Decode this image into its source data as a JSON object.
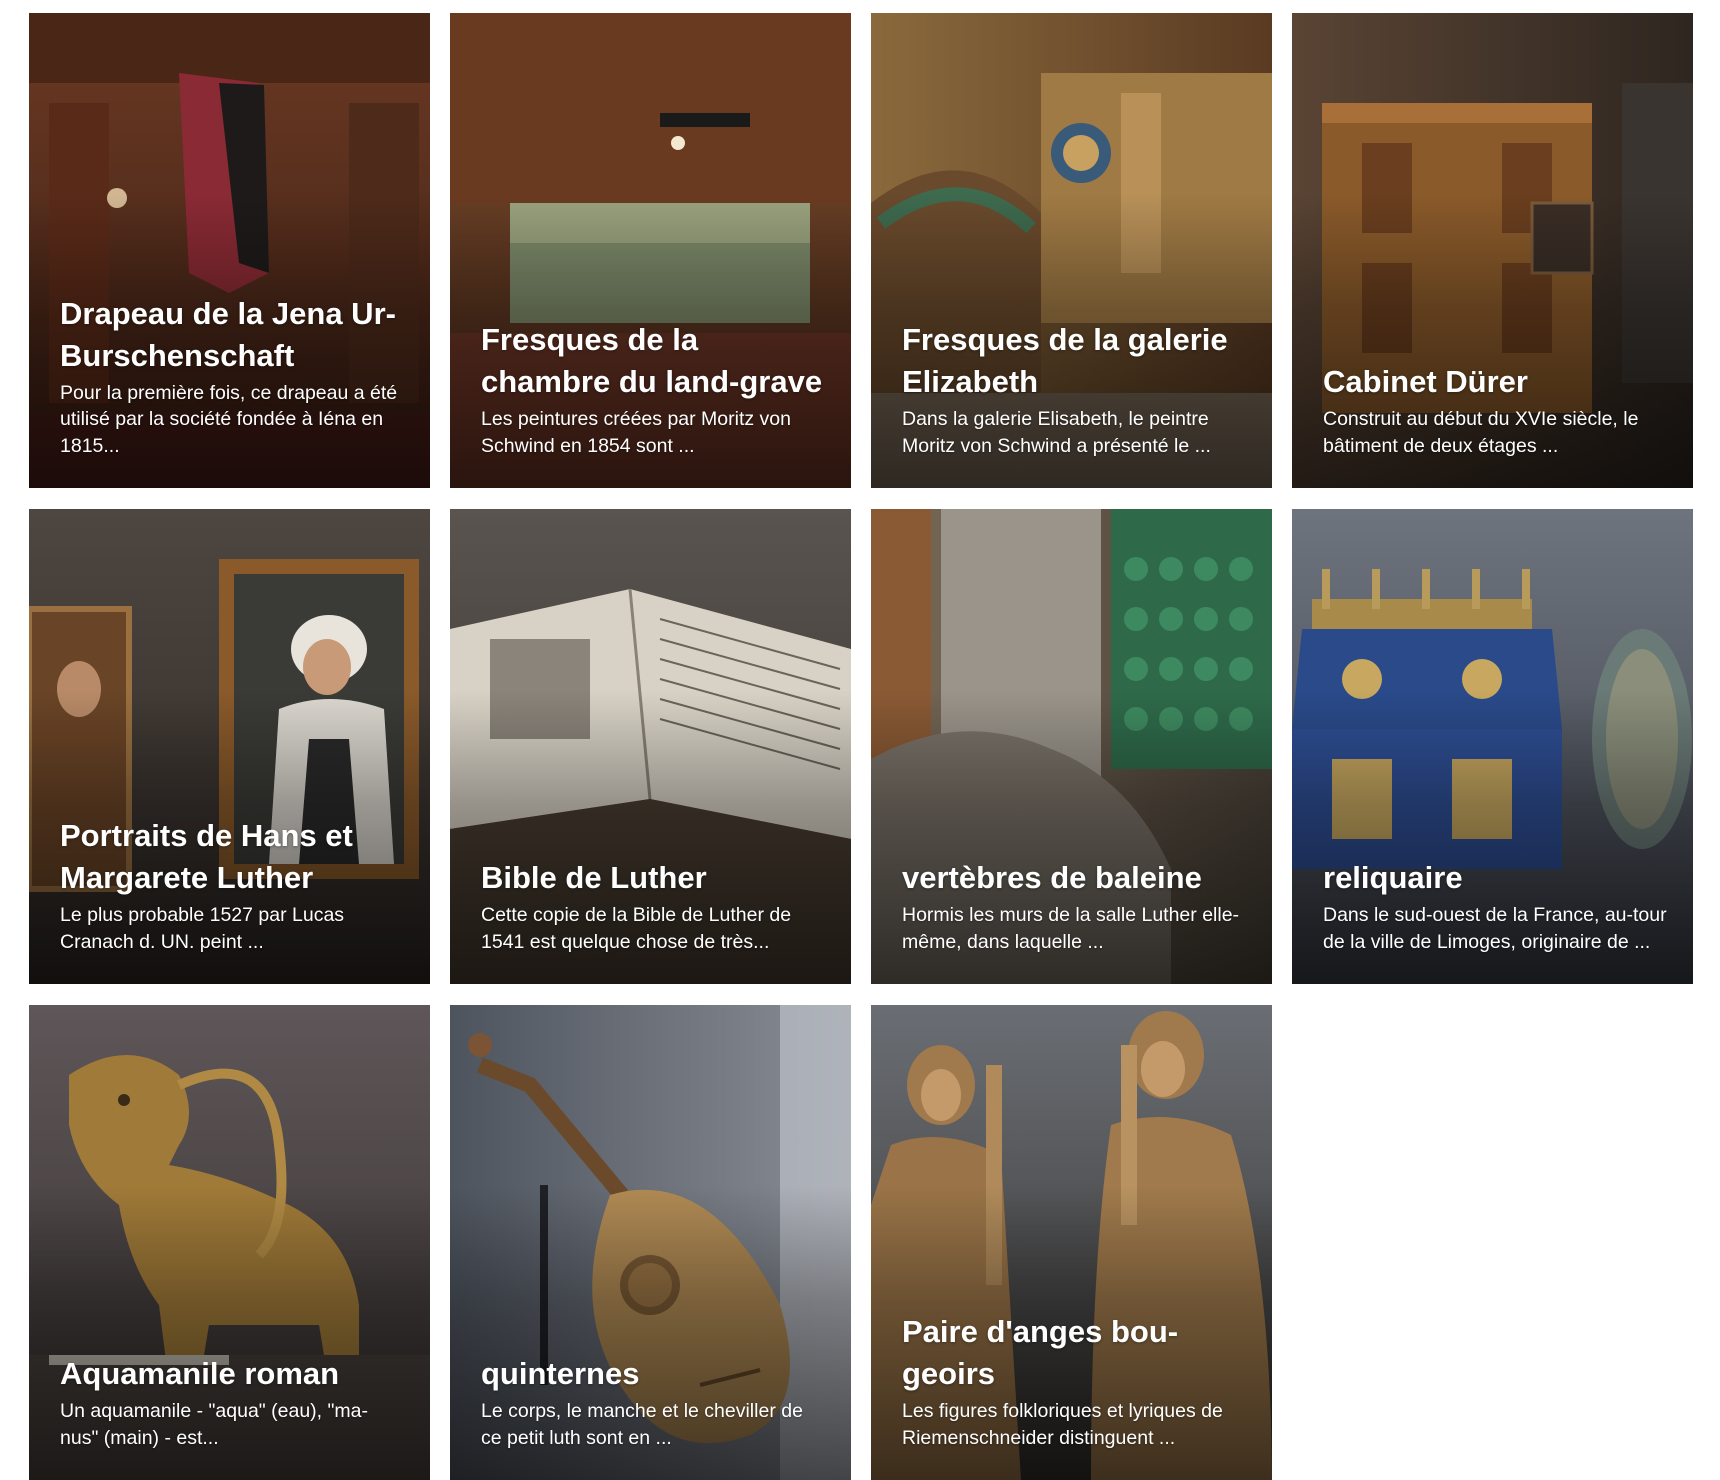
{
  "cards": [
    {
      "title": "Drapeau de la Jena Ur-Burschenschaft",
      "excerpt": "Pour la première fois, ce drapeau a été utilisé par la société fondée à Iéna en 1815...",
      "image": "hall-with-flag",
      "colors": [
        "#6b3a24",
        "#3a1d12"
      ]
    },
    {
      "title": "Fresques de la chambre du land-grave",
      "excerpt": "Les peintures créées par Moritz von Schwind en 1854 sont ...",
      "image": "room-with-fresco",
      "colors": [
        "#7a4a2b",
        "#4a2a1a"
      ]
    },
    {
      "title": "Fresques de la galerie Elizabeth",
      "excerpt": "Dans la galerie Elisabeth, le peintre Moritz von Schwind a présenté le ...",
      "image": "painted-gallery",
      "colors": [
        "#8a6a3c",
        "#5a3a22"
      ]
    },
    {
      "title": "Cabinet Dürer",
      "excerpt": "Construit au début du XVIe siècle, le bâtiment de deux étages ...",
      "image": "wooden-cabinet",
      "colors": [
        "#6b4a2a",
        "#3a2a1e"
      ]
    },
    {
      "title": "Portraits de Hans et Margarete Luther",
      "excerpt": "Le plus probable 1527 par Lucas Cranach d. UN. peint ...",
      "image": "framed-portraits",
      "colors": [
        "#4e4640",
        "#2e2824"
      ]
    },
    {
      "title": "Bible de Luther",
      "excerpt": "Cette copie de la Bible de Luther de 1541 est quelque chose de très...",
      "image": "open-book",
      "colors": [
        "#5a5450",
        "#36302c"
      ]
    },
    {
      "title": "vertèbres de baleine",
      "excerpt": "Hormis les murs de la salle Luther elle-même, dans laquelle ...",
      "image": "whale-vertebra-and-stove",
      "colors": [
        "#6e6254",
        "#3a4a3a"
      ]
    },
    {
      "title": "reliquaire",
      "excerpt": "Dans le sud-ouest de la France, au-tour de la ville de Limoges, originaire de ...",
      "image": "enamel-reliquary",
      "colors": [
        "#5e6470",
        "#3a3e48"
      ]
    },
    {
      "title": "Aquamanile roman",
      "excerpt": "Un aquamanile - \"aqua\" (eau), \"ma-nus\" (main) - est...",
      "image": "bronze-lion",
      "colors": [
        "#5a5254",
        "#36302e"
      ]
    },
    {
      "title": "quinternes",
      "excerpt": "Le corps, le manche et le cheviller de ce petit luth sont en ...",
      "image": "lute",
      "colors": [
        "#5e6470",
        "#33373e"
      ]
    },
    {
      "title": "Paire d'anges bou-geoirs",
      "excerpt": "Les figures folkloriques et lyriques de Riemenschneider distinguent ...",
      "image": "wooden-angels",
      "colors": [
        "#5a5e64",
        "#33302c"
      ]
    }
  ]
}
